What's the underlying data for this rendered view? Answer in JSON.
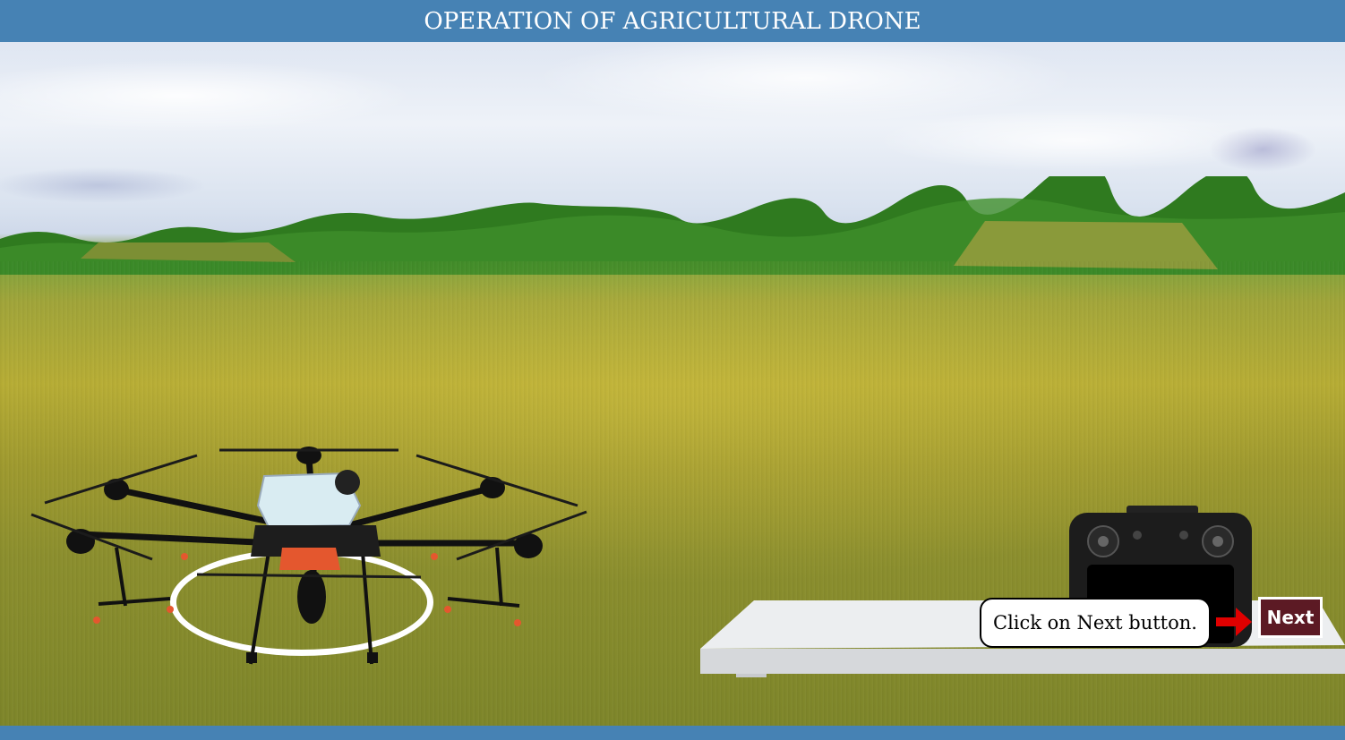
{
  "header": {
    "title": "OPERATION OF AGRICULTURAL DRONE"
  },
  "instruction": {
    "text": "Click on Next button."
  },
  "next_button": {
    "label": "Next"
  },
  "icons": {
    "arrow": "arrow-right-icon"
  },
  "colors": {
    "header_bg": "#4682b4",
    "next_bg": "#5c1a24",
    "arrow": "#e00000"
  }
}
